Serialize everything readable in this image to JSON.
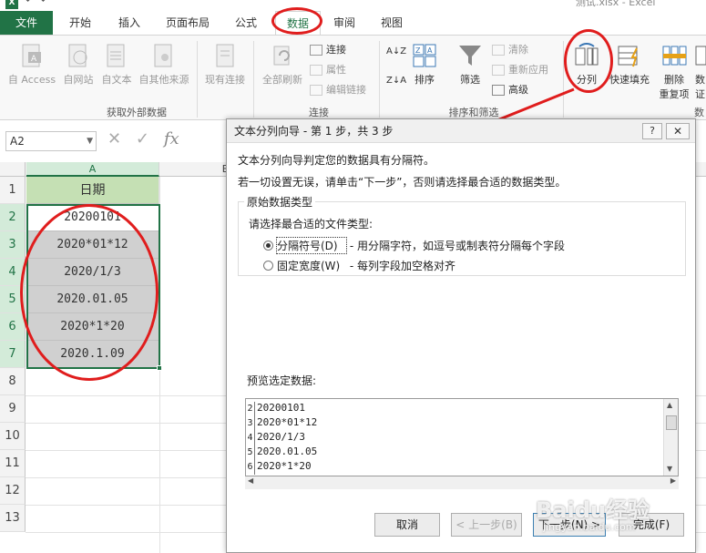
{
  "app": {
    "doc_title": "测试.xlsx - Excel",
    "icon": "excel-icon"
  },
  "ribbon": {
    "tabs": [
      "文件",
      "开始",
      "插入",
      "页面布局",
      "公式",
      "数据",
      "审阅",
      "视图"
    ],
    "active_tab": "数据",
    "get_external": {
      "buttons": [
        "自 Access",
        "自网站",
        "自文本",
        "自其他来源",
        "现有连接"
      ],
      "group_label": "获取外部数据"
    },
    "connections": {
      "refresh_label": "全部刷新",
      "items": [
        "连接",
        "属性",
        "编辑链接"
      ],
      "group_label": "连接"
    },
    "sort_filter": {
      "sort_label": "排序",
      "filter_label": "筛选",
      "items": [
        "清除",
        "重新应用",
        "高级"
      ],
      "group_label": "排序和筛选"
    },
    "tools": {
      "split_label": "分列",
      "flash_fill_label": "快速填充",
      "remove_dup_line1": "删除",
      "remove_dup_line2": "重复项",
      "more_line1": "数",
      "more_line2": "证",
      "group_label_partial": "数"
    }
  },
  "formula_bar": {
    "name_box": "A2",
    "cancel_icon": "✕",
    "enter_icon": "✓",
    "fx": "fx"
  },
  "sheet": {
    "columns": [
      "A",
      "B"
    ],
    "rows": [
      "1",
      "2",
      "3",
      "4",
      "5",
      "6",
      "7",
      "8",
      "9",
      "10",
      "11",
      "12",
      "13"
    ],
    "header_cell": "日期",
    "values": [
      "20200101",
      "2020*01*12",
      "2020/1/3",
      "2020.01.05",
      "2020*1*20",
      "2020.1.09"
    ]
  },
  "dialog": {
    "title": "文本分列向导 - 第 1 步，共 3 步",
    "help_label": "?",
    "close_label": "✕",
    "line1": "文本分列向导判定您的数据具有分隔符。",
    "line2": "若一切设置无误，请单击“下一步”，否则请选择最合适的数据类型。",
    "group_title": "原始数据类型",
    "prompt": "请选择最合适的文件类型:",
    "options": [
      {
        "label": "分隔符号(D)",
        "desc": "- 用分隔字符，如逗号或制表符分隔每个字段",
        "checked": true
      },
      {
        "label": "固定宽度(W)",
        "desc": "- 每列字段加空格对齐",
        "checked": false
      }
    ],
    "preview_label": "预览选定数据:",
    "preview_rows": [
      {
        "num": "2",
        "text": "20200101"
      },
      {
        "num": "3",
        "text": "2020*01*12"
      },
      {
        "num": "4",
        "text": "2020/1/3"
      },
      {
        "num": "5",
        "text": "2020.01.05"
      },
      {
        "num": "6",
        "text": "2020*1*20"
      }
    ],
    "buttons": {
      "cancel": "取消",
      "back": "< 上一步(B)",
      "next": "下一步(N) >",
      "finish": "完成(F)"
    }
  },
  "colors": {
    "excel_green": "#217346",
    "header_fill": "#c5e0b4",
    "annotation_red": "#e01d1d",
    "selection_gray": "#d0d0d0"
  },
  "watermark": {
    "brand": "Baidu经验",
    "url": "jingyan.baidu.com"
  }
}
